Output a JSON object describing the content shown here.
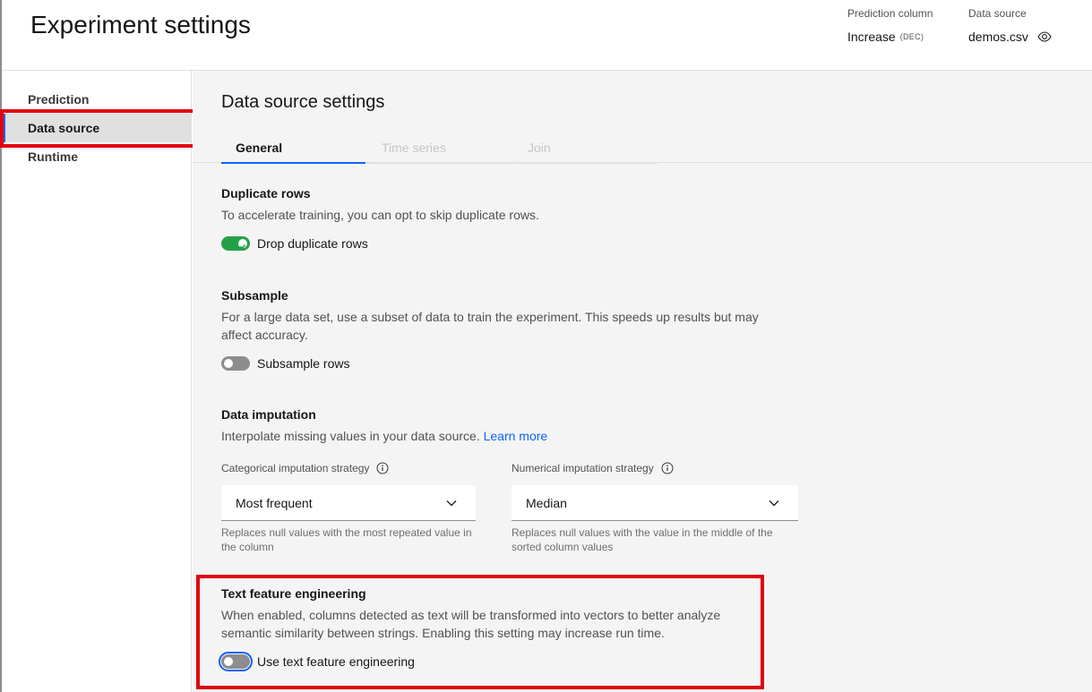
{
  "header": {
    "title": "Experiment settings",
    "prediction_column_label": "Prediction column",
    "prediction_column_value": "Increase",
    "prediction_column_tag": "(DEC)",
    "data_source_label": "Data source",
    "data_source_value": "demos.csv"
  },
  "sidebar": {
    "items": [
      {
        "label": "Prediction"
      },
      {
        "label": "Data source"
      },
      {
        "label": "Runtime"
      }
    ]
  },
  "main": {
    "section_title": "Data source settings",
    "tabs": [
      {
        "label": "General"
      },
      {
        "label": "Time series"
      },
      {
        "label": "Join"
      }
    ],
    "duplicate_rows": {
      "heading": "Duplicate rows",
      "description": "To accelerate training, you can opt to skip duplicate rows.",
      "toggle_label": "Drop duplicate rows"
    },
    "subsample": {
      "heading": "Subsample",
      "description": "For a large data set, use a subset of data to train the experiment. This speeds up results but may affect accuracy.",
      "toggle_label": "Subsample rows"
    },
    "data_imputation": {
      "heading": "Data imputation",
      "description": "Interpolate missing values in your data source.",
      "link": "Learn more",
      "categorical": {
        "label": "Categorical imputation strategy",
        "value": "Most frequent",
        "helper": "Replaces null values with the most repeated value in the column"
      },
      "numerical": {
        "label": "Numerical imputation strategy",
        "value": "Median",
        "helper": "Replaces null values with the value in the middle of the sorted column values"
      }
    },
    "text_feature": {
      "heading": "Text feature engineering",
      "description": "When enabled, columns detected as text will be transformed into vectors to better analyze semantic similarity between strings. Enabling this setting may increase run time.",
      "toggle_label": "Use text feature engineering"
    }
  },
  "colors": {
    "accent": "#0f62fe",
    "toggle_on": "#24a148",
    "toggle_off": "#8d8d8d",
    "highlight": "#e0000f"
  }
}
